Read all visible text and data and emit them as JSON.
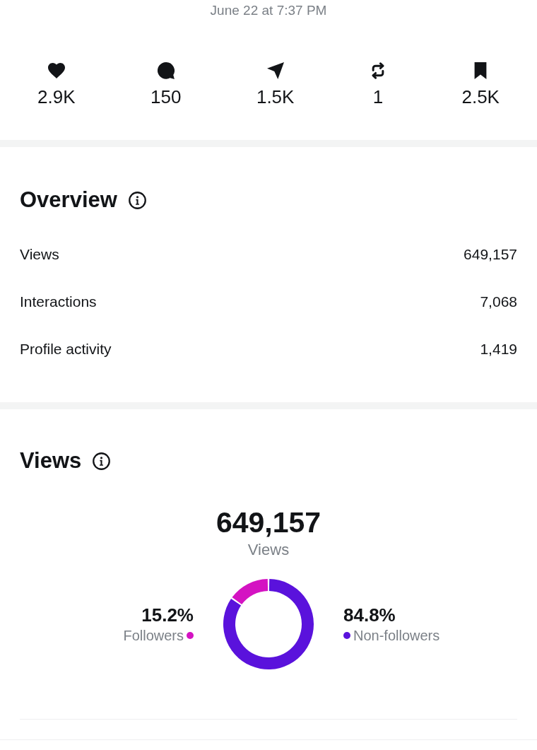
{
  "timestamp": "June 22 at 7:37 PM",
  "stats": [
    {
      "kind": "heart",
      "value": "2.9K"
    },
    {
      "kind": "comment",
      "value": "150"
    },
    {
      "kind": "send",
      "value": "1.5K"
    },
    {
      "kind": "repost",
      "value": "1"
    },
    {
      "kind": "bookmark",
      "value": "2.5K"
    }
  ],
  "overview": {
    "title": "Overview",
    "metrics": [
      {
        "label": "Views",
        "value": "649,157"
      },
      {
        "label": "Interactions",
        "value": "7,068"
      },
      {
        "label": "Profile activity",
        "value": "1,419"
      }
    ]
  },
  "views": {
    "title": "Views",
    "total": "649,157",
    "total_label": "Views",
    "chart_data": {
      "type": "donut",
      "categories": [
        "Followers",
        "Non-followers"
      ],
      "values": [
        15.2,
        84.8
      ],
      "colors": [
        "#d413c2",
        "#5a12dc"
      ],
      "value_labels": [
        "15.2%",
        "84.8%"
      ]
    }
  }
}
